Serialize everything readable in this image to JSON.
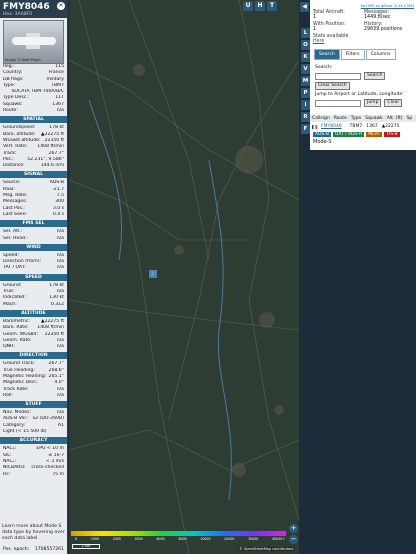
{
  "header": {
    "callsign": "FMY8046",
    "hex": "Hex: 3AA8F0"
  },
  "photo": {
    "caption": "Image © Raffi Pham"
  },
  "reg": [
    [
      "Reg.:",
      "115"
    ],
    [
      "Country:",
      "France"
    ],
    [
      "DB flags:",
      "military"
    ],
    [
      "Type:",
      "TBM7"
    ],
    [
      "",
      "SOCATA TBM-700A/B/C"
    ],
    [
      "Type Desc.:",
      "L1T"
    ],
    [
      "Squawk:",
      "1367"
    ],
    [
      "Route:",
      "n/a"
    ]
  ],
  "sections": {
    "spatial": "SPATIAL",
    "signal": "SIGNAL",
    "fms": "FMS SEL",
    "wind": "WIND",
    "speed": "SPEED",
    "altitude": "ALTITUDE",
    "direction": "DIRECTION",
    "stuff": "STUFF",
    "accuracy": "ACCURACY"
  },
  "spatial": [
    [
      "Groundspeed:",
      "178 kt"
    ],
    [
      "Baro. altitude:",
      "▲22275 ft"
    ],
    [
      "WGS84 altitude:",
      "22350 ft"
    ],
    [
      "Vert. Rate:",
      "1408 ft/min"
    ],
    [
      "Track:",
      "267.7°"
    ],
    [
      "Pos.:",
      "52.231°, 9.586°"
    ],
    [
      "Distance:",
      "144.6 nmi"
    ]
  ],
  "signal": [
    [
      "Source:",
      "ADS-B"
    ],
    [
      "RSSI:",
      "-21.7"
    ],
    [
      "Msg. Rate:",
      "7.5"
    ],
    [
      "Messages:",
      "300"
    ],
    [
      "Last Pos.:",
      "3.0 s"
    ],
    [
      "Last Seen:",
      "0.4 s"
    ]
  ],
  "fms": [
    [
      "Sel. Alt.:",
      "n/a"
    ],
    [
      "Sel. Head.:",
      "n/a"
    ]
  ],
  "wind": [
    [
      "Speed:",
      "n/a"
    ],
    [
      "Direction (from):",
      "n/a"
    ],
    [
      "TAT / OAT:",
      "n/a"
    ]
  ],
  "speed": [
    [
      "Ground:",
      "178 kt"
    ],
    [
      "True:",
      "n/a"
    ],
    [
      "Indicated:",
      "130 kt"
    ],
    [
      "Mach:",
      "0.312"
    ]
  ],
  "altitude": [
    [
      "Barometric:",
      "▲22275 ft"
    ],
    [
      "Baro. Rate:",
      "1408 ft/min"
    ],
    [
      "Geom. WGS84:",
      "22350 ft"
    ],
    [
      "Geom. Rate:",
      "n/a"
    ],
    [
      "QNH:",
      "n/a"
    ]
  ],
  "direction": [
    [
      "Ground Track:",
      "267.7°"
    ],
    [
      "True Heading:",
      "268.6°"
    ],
    [
      "Magnetic Heading:",
      "265.1°"
    ],
    [
      "Magnetic Decl.:",
      "4.0°"
    ],
    [
      "Track Rate:",
      "n/a"
    ],
    [
      "Roll:",
      "n/a"
    ]
  ],
  "stuff": [
    [
      "Nav. Modes:",
      "n/a"
    ],
    [
      "ADS-B Ver.:",
      "v2 (DO-260B)"
    ],
    [
      "Category:",
      "A1"
    ],
    [
      "Light (< 15 500 lb)",
      ""
    ]
  ],
  "accuracy": [
    [
      "NACₚ:",
      "EPU < 10 m"
    ],
    [
      "SIL:",
      "≤ 1e-7"
    ],
    [
      "NACᵥ:",
      "< 3 m/s"
    ],
    [
      "NICBARO:",
      "cross-checked"
    ],
    [
      "Rc:",
      "75 m"
    ]
  ],
  "footer": {
    "text": "Learn more about Mode S data type by hovering over each data label.",
    "pos_label": "Pos. epoch:",
    "pos_value": "1708557261"
  },
  "topbar": {
    "u": "U",
    "h": "H",
    "t": "T"
  },
  "vbuttons": [
    "L",
    "O",
    "K",
    "V",
    "M",
    "P",
    "I",
    "R",
    "F"
  ],
  "zoom": {
    "in": "+",
    "out": "−"
  },
  "legend": {
    "ticks": [
      "0",
      "1000",
      "2000",
      "4000",
      "6000",
      "8000",
      "10000",
      "20000",
      "30000",
      "40000+"
    ]
  },
  "scale": "2 km",
  "attrib": "© OpenStreetMap contributors",
  "right": {
    "link": "tar1090 on github (3.14.1706)",
    "stats": [
      [
        "Total Aircraft:",
        "1"
      ],
      [
        "Messages:",
        "1449.8/sec"
      ],
      [
        "With Position:",
        "1"
      ],
      [
        "History:",
        "29639 positions"
      ],
      [
        "Stats available",
        "Here"
      ],
      [
        "",
        ""
      ]
    ],
    "tabs": [
      "Search",
      "Filters",
      "Columns"
    ],
    "search_label": "Search:",
    "search_btn": "Search",
    "clear_btn": "Clear Search",
    "jump_label": "Jump to Airport or Latitude, Longitude:",
    "jump_btn": "Jump",
    "jclear_btn": "Clear",
    "thead": [
      "Callsign",
      "Route",
      "Type",
      "Squawk",
      "Alt. (ft)",
      "Sp"
    ],
    "trow": [
      "FMY8046",
      "",
      "TBM7",
      "1367",
      "▲22275"
    ],
    "badges": [
      "ADS-B",
      "UAT / ADS-R",
      "MLAT",
      "TIS-B"
    ],
    "badge_colors": [
      "#1c6b9c",
      "#1c7c4a",
      "#b05c00",
      "#b51c1c"
    ],
    "modes": "Mode-S"
  }
}
